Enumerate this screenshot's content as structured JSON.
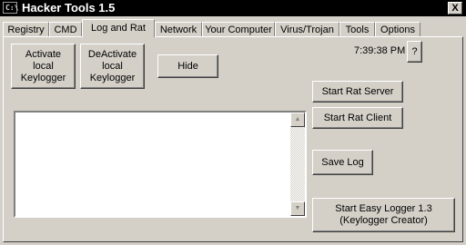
{
  "window": {
    "title": "Hacker Tools 1.5",
    "close_label": "X"
  },
  "tabs": [
    {
      "label": "Registry"
    },
    {
      "label": "CMD"
    },
    {
      "label": "Log and Rat",
      "active": true
    },
    {
      "label": "Network"
    },
    {
      "label": "Your Computer"
    },
    {
      "label": "Virus/Trojan"
    },
    {
      "label": "Tools"
    },
    {
      "label": "Options"
    }
  ],
  "panel": {
    "activate_label": "Activate\nlocal\nKeylogger",
    "deactivate_label": "DeActivate\nlocal\nKeylogger",
    "hide_label": "Hide",
    "time": "7:39:38 PM",
    "help_label": "?",
    "start_rat_server_label": "Start Rat Server",
    "start_rat_client_label": "Start Rat Client",
    "save_log_label": "Save Log",
    "easy_logger_label": "Start Easy Logger 1.3\n(Keylogger Creator)",
    "log_text": ""
  },
  "icons": {
    "app": "console-icon",
    "scroll_up": "scroll-up-arrow-icon",
    "scroll_down": "scroll-down-arrow-icon"
  }
}
